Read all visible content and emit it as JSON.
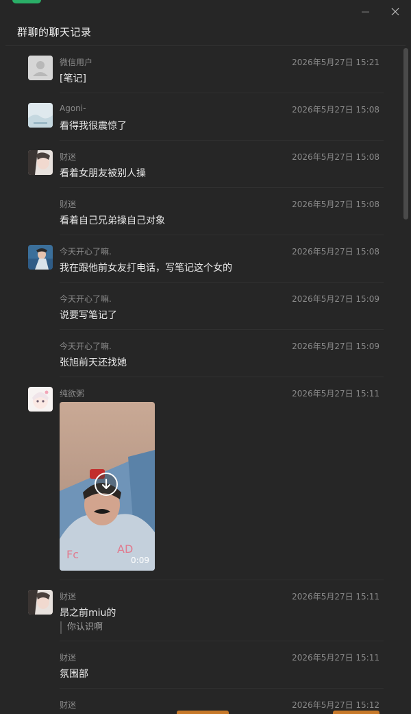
{
  "window": {
    "title": "群聊的聊天记录",
    "accent_color": "#2aae67",
    "minimize_icon": "minimize-icon",
    "close_icon": "close-icon"
  },
  "messages": [
    {
      "name": "微信用户",
      "time": "2026年5月27日 15:21",
      "text": "[笔记]",
      "avatar": "default-avatar"
    },
    {
      "name": "Agoni-",
      "time": "2026年5月27日 15:08",
      "text": "看得我很震惊了",
      "avatar": "landscape-avatar"
    },
    {
      "name": "财迷",
      "time": "2026年5月27日 15:08",
      "text": "看着女朋友被别人操",
      "avatar": "portrait-avatar"
    },
    {
      "name": "财迷",
      "time": "2026年5月27日 15:08",
      "text": "看着自己兄弟操自己对象",
      "avatar": ""
    },
    {
      "name": "今天开心了嘛.",
      "time": "2026年5月27日 15:08",
      "text": "我在跟他前女友打电话，写笔记这个女的",
      "avatar": "beach-avatar"
    },
    {
      "name": "今天开心了嘛.",
      "time": "2026年5月27日 15:09",
      "text": "说要写笔记了",
      "avatar": ""
    },
    {
      "name": "今天开心了嘛.",
      "time": "2026年5月27日 15:09",
      "text": "张旭前天还找她",
      "avatar": ""
    },
    {
      "name": "纯欲粥",
      "time": "2026年5月27日 15:11",
      "video_duration": "0:09",
      "avatar": "anime-avatar",
      "video_icon": "download-icon"
    },
    {
      "name": "财迷",
      "time": "2026年5月27日 15:11",
      "text": "昂之前miu的",
      "quote": "你认识啊",
      "avatar": "portrait-avatar"
    },
    {
      "name": "财迷",
      "time": "2026年5月27日 15:11",
      "text": "氛围部",
      "avatar": ""
    },
    {
      "name": "财迷",
      "time": "2026年5月27日 15:12",
      "text": "",
      "avatar": ""
    }
  ]
}
